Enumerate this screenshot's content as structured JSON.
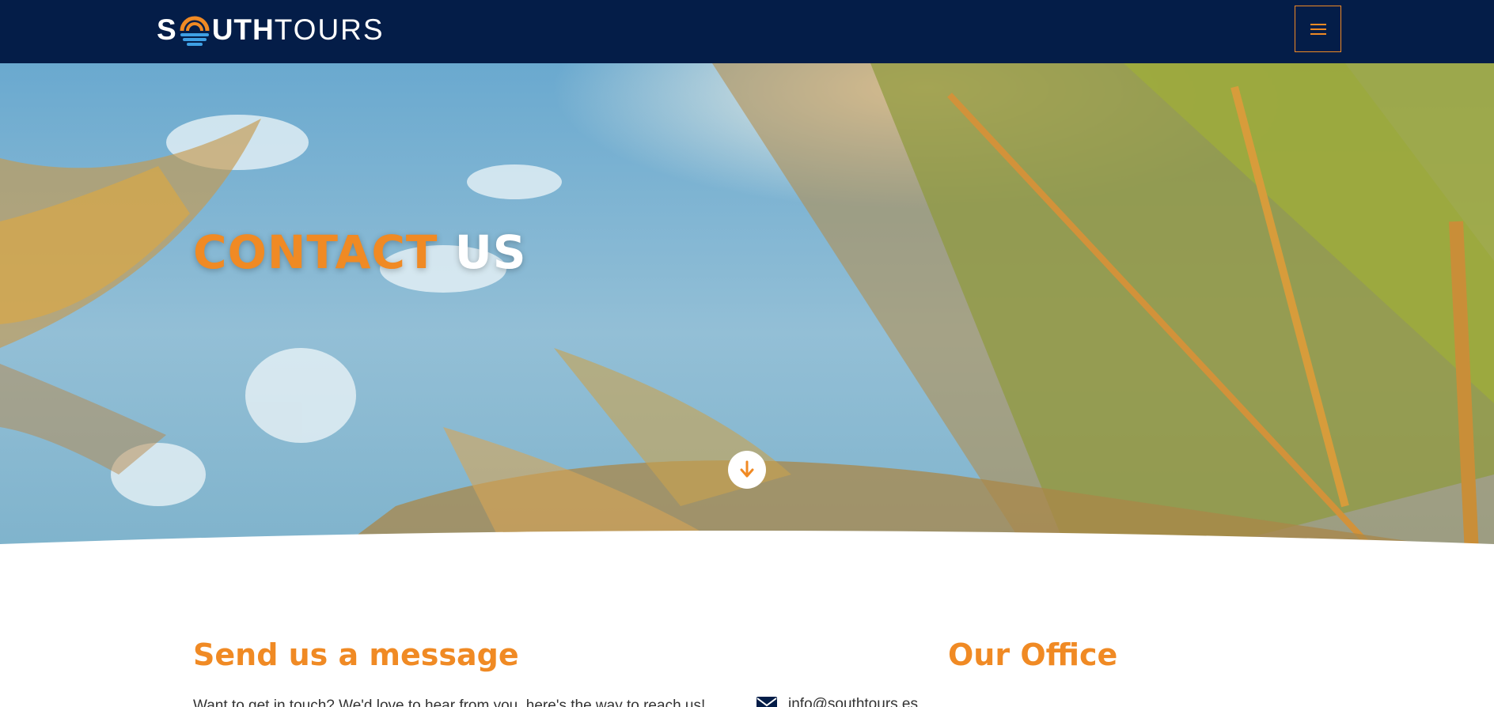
{
  "header": {
    "logo_bold": "S",
    "logo_bold_rest": "UTH",
    "logo_light": "TOURS",
    "menu_icon": "hamburger-menu-icon"
  },
  "hero": {
    "title_accent": "CONTACT",
    "title_rest": "US",
    "scroll_icon": "arrow-down-icon"
  },
  "contact": {
    "heading": "Send us a message",
    "intro": "Want to get in touch? We'd love to hear from you, here's the way to reach us!",
    "email": "info@southtours.es",
    "email_icon": "envelope-icon"
  },
  "office": {
    "heading": "Our Office"
  },
  "colors": {
    "navy": "#041d48",
    "accent": "#f08a24",
    "white": "#ffffff"
  }
}
